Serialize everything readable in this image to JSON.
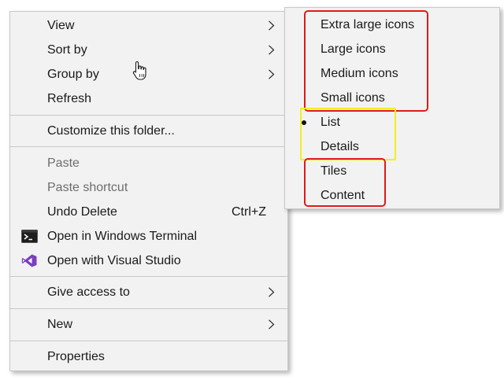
{
  "context_menu": {
    "items": [
      {
        "label": "View"
      },
      {
        "label": "Sort by"
      },
      {
        "label": "Group by"
      },
      {
        "label": "Refresh"
      },
      {
        "label": "Customize this folder..."
      },
      {
        "label": "Paste"
      },
      {
        "label": "Paste shortcut"
      },
      {
        "label": "Undo Delete",
        "shortcut": "Ctrl+Z"
      },
      {
        "label": "Open in Windows Terminal",
        "icon": "terminal-icon"
      },
      {
        "label": "Open with Visual Studio",
        "icon": "visual-studio-icon"
      },
      {
        "label": "Give access to"
      },
      {
        "label": "New"
      },
      {
        "label": "Properties"
      }
    ]
  },
  "view_submenu": {
    "items": [
      {
        "label": "Extra large icons"
      },
      {
        "label": "Large icons"
      },
      {
        "label": "Medium icons"
      },
      {
        "label": "Small icons"
      },
      {
        "label": "List",
        "selected": true
      },
      {
        "label": "Details"
      },
      {
        "label": "Tiles"
      },
      {
        "label": "Content"
      }
    ]
  },
  "annotations": {
    "red_color": "#e01a1a",
    "yellow_color": "#f2ee1f"
  },
  "colors": {
    "menu_background": "#f2f2f2",
    "disabled_text": "#6d6d6d",
    "visual_studio_purple": "#7a3fbf"
  }
}
